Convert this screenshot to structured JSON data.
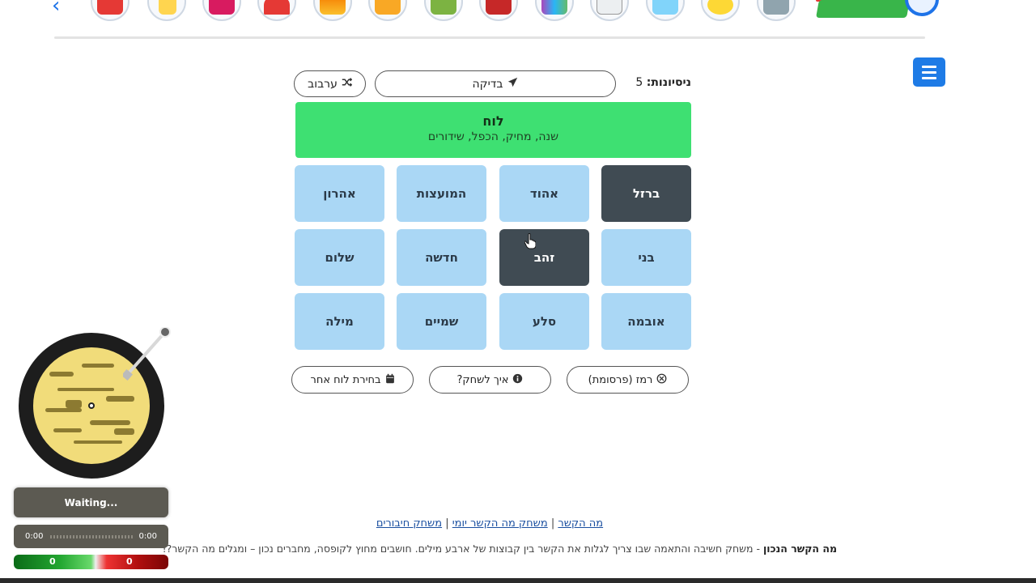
{
  "menu": {
    "icon": "hamburger-icon"
  },
  "controls": {
    "attempts_label": "ניסיונות:",
    "attempts_value": "5",
    "check_label": "בדיקה",
    "check_icon": "paper-plane-icon",
    "shuffle_label": "ערבוב",
    "shuffle_icon": "shuffle-icon"
  },
  "solved_group": {
    "title": "לוח",
    "words": "שנה, מחיק, הכפל, שידורים",
    "color": "#3ee072"
  },
  "tiles": [
    {
      "label": "ברזל",
      "selected": true
    },
    {
      "label": "אהוד",
      "selected": false
    },
    {
      "label": "המועצות",
      "selected": false
    },
    {
      "label": "אהרון",
      "selected": false
    },
    {
      "label": "בני",
      "selected": false
    },
    {
      "label": "זהב",
      "selected": true
    },
    {
      "label": "חדשה",
      "selected": false
    },
    {
      "label": "שלום",
      "selected": false
    },
    {
      "label": "אובמה",
      "selected": false
    },
    {
      "label": "סלע",
      "selected": false
    },
    {
      "label": "שמיים",
      "selected": false
    },
    {
      "label": "מילה",
      "selected": false
    }
  ],
  "tile_colors": {
    "default": "#aad7f5",
    "selected": "#404b53"
  },
  "actions": {
    "hint_label": "רמז (פרסומת)",
    "hint_icon": "circle-x-icon",
    "howto_label": "איך לשחק?",
    "howto_icon": "info-icon",
    "choose_board_label": "בחירת לוח אחר",
    "choose_board_icon": "calendar-icon"
  },
  "footer": {
    "link1": "מה הקשר",
    "link2": "משחק מה הקשר יומי",
    "link3": "משחק חיבורים",
    "separator": "|",
    "desc_bold": "מה הקשר הנכון",
    "desc_text": " - משחק חשיבה והתאמה שבו צריך לגלות את הקשר בין קבוצות של ארבע מילים. חושבים מחוץ לקופסה, מחברים נכון – ומגלים מה הקשר?!"
  },
  "player": {
    "status": "Waiting...",
    "time_current": "0:00",
    "time_total": "0:00",
    "score_left": "0",
    "score_right": "0"
  },
  "top_icons": [
    "chevron-left-icon",
    "characters-icon",
    "lightbulb-icon",
    "camera-icon",
    "pie-chart-icon",
    "stack-icon",
    "robot-icon",
    "picture-icon",
    "year-2026-icon",
    "palette-icon",
    "cloud-icon",
    "question-icon",
    "smiley-icon",
    "gamepad-icon",
    "site-logo"
  ]
}
